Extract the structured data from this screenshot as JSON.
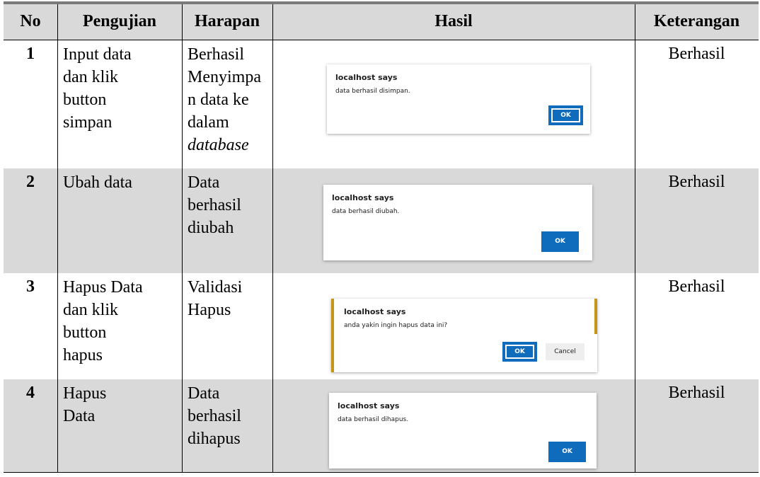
{
  "headers": [
    "No",
    "Pengujian",
    "Harapan",
    "Hasil",
    "Keterangan"
  ],
  "rows": [
    {
      "no": "1",
      "pengujian": [
        "Input data",
        "dan klik",
        "button",
        "simpan"
      ],
      "harapan": [
        "Berhasil",
        "Menyimpa",
        "n data ke",
        "dalam"
      ],
      "harapan_italic": "database",
      "dialog": {
        "title": "localhost says",
        "message": "data berhasil disimpan.",
        "ok": "OK"
      },
      "keterangan": "Berhasil"
    },
    {
      "no": "2",
      "pengujian": [
        "Ubah data"
      ],
      "harapan": [
        "Data",
        "berhasil",
        "diubah"
      ],
      "dialog": {
        "title": "localhost says",
        "message": "data berhasil diubah.",
        "ok": "OK"
      },
      "keterangan": "Berhasil"
    },
    {
      "no": "3",
      "pengujian": [
        "Hapus Data",
        "dan klik",
        "button",
        "hapus"
      ],
      "harapan": [
        "Validasi",
        "Hapus"
      ],
      "dialog": {
        "title": "localhost says",
        "message": "anda yakin ingin hapus data ini?",
        "ok": "OK",
        "cancel": "Cancel"
      },
      "keterangan": "Berhasil"
    },
    {
      "no": "4",
      "pengujian": [
        "Hapus",
        "Data"
      ],
      "harapan": [
        "Data",
        "berhasil",
        "dihapus"
      ],
      "dialog": {
        "title": "localhost says",
        "message": "data berhasil dihapus.",
        "ok": "OK"
      },
      "keterangan": "Berhasil"
    }
  ],
  "colors": {
    "shade": "#d9d9d9",
    "ok_button": "#0f6cbd",
    "accent": "#c59518"
  }
}
